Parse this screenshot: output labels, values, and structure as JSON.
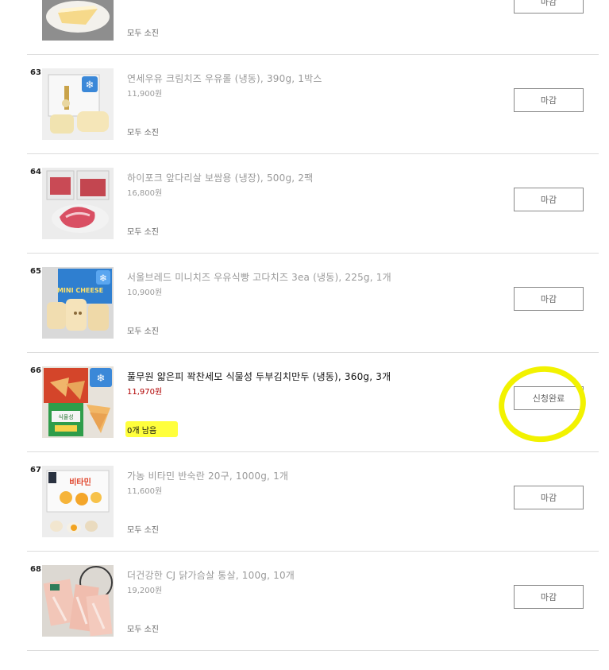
{
  "rows": [
    {
      "num": "",
      "title": "",
      "price": "",
      "status": "모두 소진",
      "button": "마감"
    },
    {
      "num": "63",
      "title": "연세우유 크림치즈 우유롤 (냉동), 390g, 1박스",
      "price": "11,900원",
      "status": "모두 소진",
      "button": "마감"
    },
    {
      "num": "64",
      "title": "하이포크 앞다리살 보쌈용 (냉장), 500g, 2팩",
      "price": "16,800원",
      "status": "모두 소진",
      "button": "마감"
    },
    {
      "num": "65",
      "title": "서울브레드 미니치즈 우유식빵 고다치즈 3ea (냉동), 225g, 1개",
      "price": "10,900원",
      "status": "모두 소진",
      "button": "마감"
    },
    {
      "num": "66",
      "title": "풀무원 얇은피 꽉찬세모 식물성 두부김치만두 (냉동), 360g, 3개",
      "price": "11,970원",
      "status": "0개 남음",
      "button": "신청완료"
    },
    {
      "num": "67",
      "title": "가농 비타민 반숙란 20구, 1000g, 1개",
      "price": "11,600원",
      "status": "모두 소진",
      "button": "마감"
    },
    {
      "num": "68",
      "title": "더건강한 CJ 닭가슴살 통살, 100g, 10개",
      "price": "19,200원",
      "status": "모두 소진",
      "button": "마감"
    }
  ],
  "thumbs": {
    "t65_label": "MINI CHEESE",
    "t66_label": "식물성",
    "t67_label": "비타민"
  },
  "colors": {
    "highlight": "#ffff3c",
    "active_price": "#b00000",
    "divider": "#dcdcdc"
  }
}
